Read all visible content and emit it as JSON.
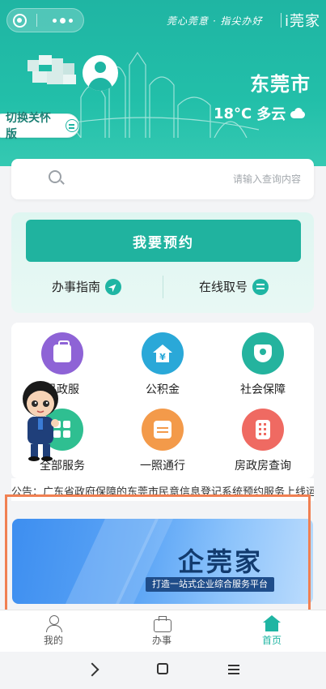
{
  "header": {
    "brand": "i莞家",
    "slogan": "莞心莞意 · 指尖办好",
    "city": "东莞市",
    "temperature": "18°C",
    "weather": "多云",
    "care_mode_label": "切换关怀版"
  },
  "search": {
    "placeholder": "请输入查询内容"
  },
  "booking": {
    "button_label": "我要预约",
    "quick_actions": [
      {
        "label": "在线取号",
        "icon": "exchange-icon"
      },
      {
        "label": "办事指南",
        "icon": "compass-icon"
      }
    ]
  },
  "services": [
    {
      "label": "社会保障",
      "icon": "shield-icon",
      "color": "#24b39e"
    },
    {
      "label": "公积金",
      "icon": "housing-fund-icon",
      "color": "#2aa8d8"
    },
    {
      "label": "民政服",
      "icon": "briefcase-icon",
      "color": "#8e63d6"
    },
    {
      "label": "房政房查询",
      "icon": "building-icon",
      "color": "#ef6a62"
    },
    {
      "label": "一照通行",
      "icon": "calendar-icon",
      "color": "#f39a4a"
    },
    {
      "label": "全部服务",
      "icon": "grid-icon",
      "color": "#2fbf91"
    }
  ],
  "notice": {
    "text": "公告：广东省政府保障的东莞市民意信息登记系统预约服务上线运营"
  },
  "banner": {
    "title": "企莞家",
    "subtitle": "打造一站式企业综合服务平台"
  },
  "tabbar": {
    "items": [
      {
        "label": "首页",
        "icon": "home-icon",
        "active": true
      },
      {
        "label": "办事",
        "icon": "briefcase-icon"
      },
      {
        "label": "我的",
        "icon": "user-icon"
      }
    ]
  },
  "colors": {
    "primary": "#1fb5a3",
    "highlight_border": "#f08052",
    "banner_blue": "#3d8ef0"
  }
}
